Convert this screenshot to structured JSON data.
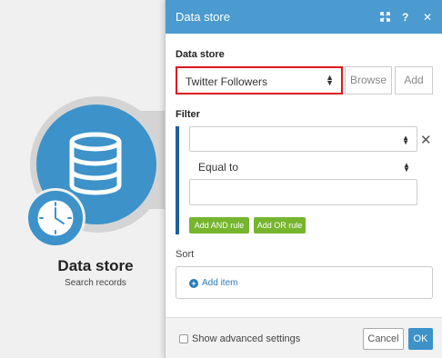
{
  "module": {
    "title": "Data store",
    "subtitle": "Search records",
    "icon": "database-icon",
    "badge_icon": "clock-icon",
    "color": "#3c92c9"
  },
  "dialog": {
    "title": "Data store",
    "header_color": "#4b9ad0",
    "header_icons": [
      "expand-icon",
      "help-icon",
      "close-icon"
    ],
    "data_store_label": "Data store",
    "data_store_value": "Twitter Followers",
    "browse_label": "Browse",
    "add_label": "Add",
    "filter_label": "Filter",
    "filter": {
      "field_value": "",
      "operator": "Equal to",
      "value": "",
      "add_and_label": "Add AND rule",
      "add_or_label": "Add OR rule"
    },
    "sort_label": "Sort",
    "add_item_label": "Add item",
    "show_advanced_label": "Show advanced settings",
    "cancel_label": "Cancel",
    "ok_label": "OK"
  }
}
